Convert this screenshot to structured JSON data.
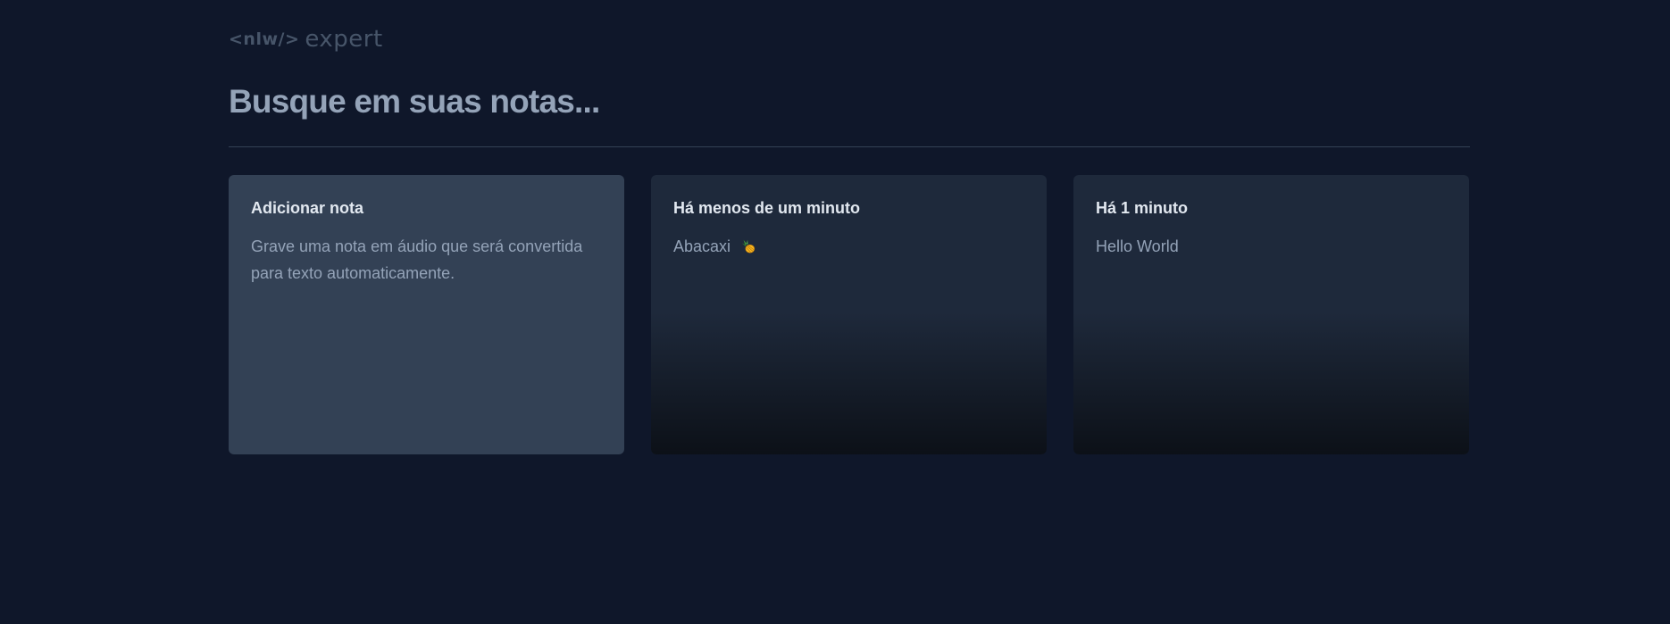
{
  "logo": {
    "code_text": "<nlw/>",
    "expert_text": "expert"
  },
  "search": {
    "placeholder": "Busque em suas notas..."
  },
  "add_card": {
    "title": "Adicionar nota",
    "description": "Grave uma nota em áudio que será convertida para texto automaticamente."
  },
  "notes": [
    {
      "date": "Há menos de um minuto",
      "content": "Abacaxi",
      "icon": "pineapple-icon"
    },
    {
      "date": "Há 1 minuto",
      "content": "Hello World"
    }
  ],
  "colors": {
    "background": "#0f172a",
    "add_card": "#334155",
    "note_card": "#1e293b",
    "muted_text": "#94a3b8"
  }
}
